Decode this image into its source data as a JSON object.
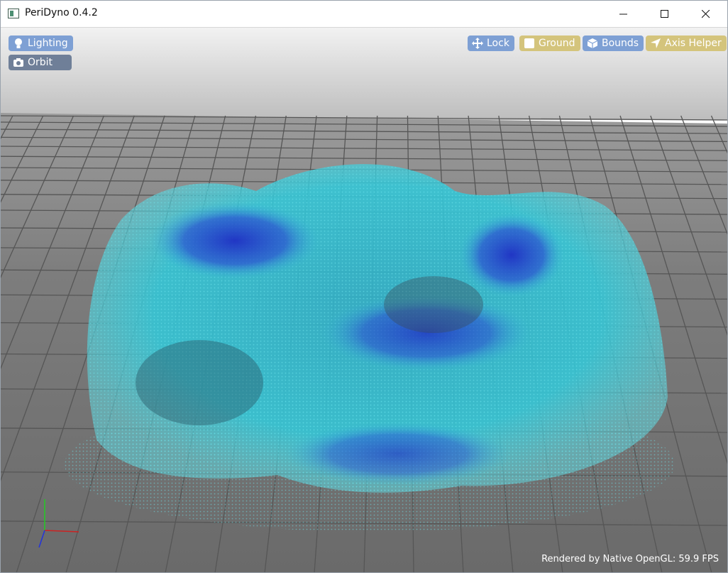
{
  "window": {
    "title": "PeriDyno 0.4.2",
    "controls": {
      "minimize_icon": "minimize-icon",
      "maximize_icon": "maximize-icon",
      "close_icon": "close-icon"
    }
  },
  "toolbar": {
    "lighting": {
      "label": "Lighting",
      "icon": "lightbulb-icon"
    },
    "orbit": {
      "label": "Orbit",
      "icon": "camera-icon"
    },
    "lock": {
      "label": "Lock",
      "icon": "move-arrows-icon"
    },
    "ground": {
      "label": "Ground",
      "icon": "square-icon"
    },
    "bounds": {
      "label": "Bounds",
      "icon": "cube-icon"
    },
    "axis_helper": {
      "label": "Axis Helper",
      "icon": "location-arrow-icon"
    }
  },
  "status": {
    "render_info": "Rendered by Native OpenGL: 59.9 FPS"
  },
  "colors": {
    "toolbar_blue": "#7ea0d4",
    "toolbar_gold": "#d4c47c",
    "toolbar_slate": "#6f7f98",
    "particle_cyan": "#33c4d0",
    "particle_blue": "#2233c0",
    "ground_grid": "#4a4a4a"
  }
}
